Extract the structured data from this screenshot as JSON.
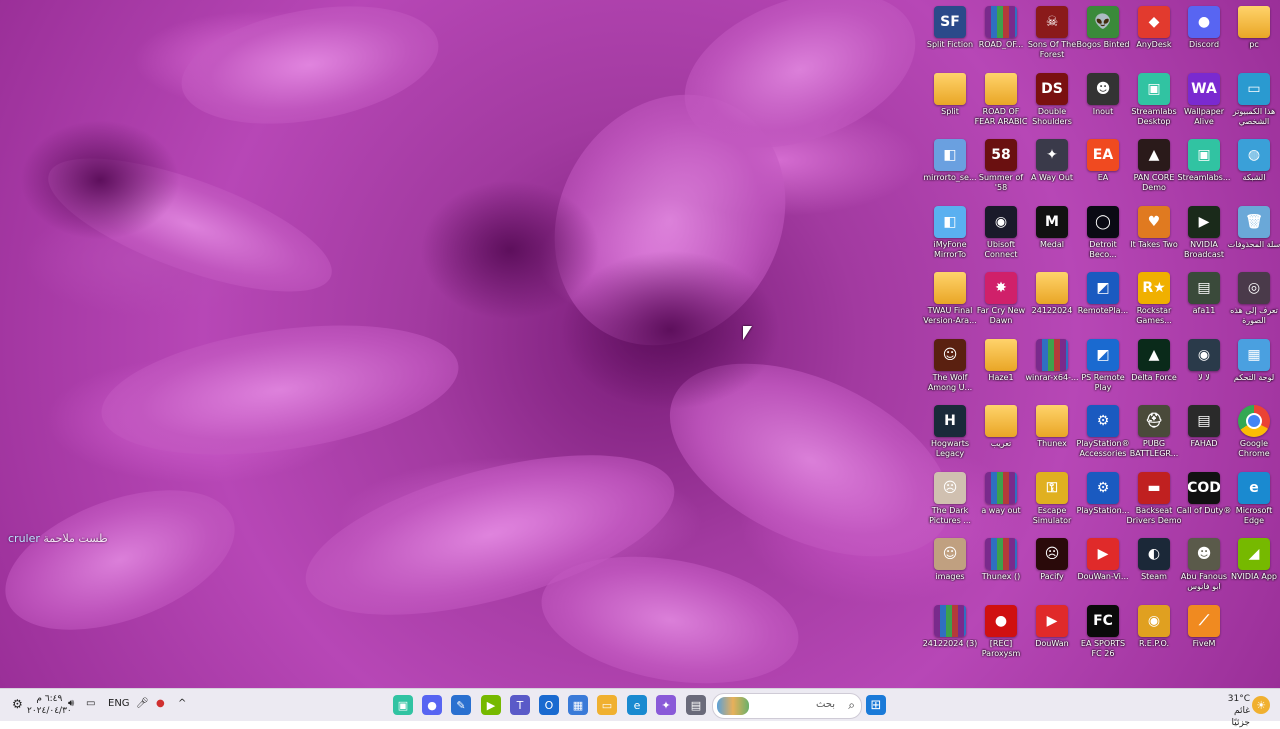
{
  "desktop": {
    "watermark": {
      "text": "طست ملاحمة",
      "brand": "cruler"
    },
    "icons": [
      {
        "label": "Split Fiction",
        "icon": "split-fiction-icon",
        "color": "#2b4a8a",
        "glyph": "SF",
        "kind": "app"
      },
      {
        "label": "ROAD_OF...",
        "icon": "winrar-archive-icon",
        "color": "#7a2a8c",
        "glyph": "",
        "kind": "rar"
      },
      {
        "label": "Sons Of The Forest",
        "icon": "sons-of-the-forest-icon",
        "color": "#8a1a1a",
        "glyph": "☠",
        "kind": "app"
      },
      {
        "label": "Bogos Binted",
        "icon": "alien-icon",
        "color": "#3a8a3a",
        "glyph": "👽",
        "kind": "app"
      },
      {
        "label": "AnyDesk",
        "icon": "anydesk-icon",
        "color": "#e23a2e",
        "glyph": "◆",
        "kind": "app"
      },
      {
        "label": "Discord",
        "icon": "discord-icon",
        "color": "#5865f2",
        "glyph": "●",
        "kind": "app"
      },
      {
        "label": "pc",
        "icon": "folder-icon",
        "color": "#f0c040",
        "glyph": "",
        "kind": "folder"
      },
      {
        "label": "Split",
        "icon": "folder-icon",
        "color": "#f0c040",
        "glyph": "",
        "kind": "folder"
      },
      {
        "label": "ROAD OF FEAR ARABIC",
        "icon": "folder-icon",
        "color": "#f0c040",
        "glyph": "",
        "kind": "folder"
      },
      {
        "label": "Double Shoulders",
        "icon": "double-shoulders-icon",
        "color": "#7a1010",
        "glyph": "DS",
        "kind": "app"
      },
      {
        "label": "Inout",
        "icon": "inout-icon",
        "color": "#333333",
        "glyph": "☻",
        "kind": "app"
      },
      {
        "label": "Streamlabs Desktop",
        "icon": "streamlabs-icon",
        "color": "#31c3a2",
        "glyph": "▣",
        "kind": "app"
      },
      {
        "label": "Wallpaper Alive",
        "icon": "wallpaper-alive-icon",
        "color": "#7a2ad0",
        "glyph": "WA",
        "kind": "app"
      },
      {
        "label": "هذا الكمبيوتر الشخصي",
        "icon": "this-pc-icon",
        "color": "#2a9ad0",
        "glyph": "▭",
        "kind": "app"
      },
      {
        "label": "mirrorto_se...",
        "icon": "mirrorto-icon",
        "color": "#6aa0e0",
        "glyph": "◧",
        "kind": "app"
      },
      {
        "label": "Summer of '58",
        "icon": "summer-of-58-icon",
        "color": "#6a1010",
        "glyph": "58",
        "kind": "app"
      },
      {
        "label": "A Way Out",
        "icon": "a-way-out-icon",
        "color": "#3a3a4a",
        "glyph": "✦",
        "kind": "app"
      },
      {
        "label": "EA",
        "icon": "ea-icon",
        "color": "#f04a20",
        "glyph": "EA",
        "kind": "app"
      },
      {
        "label": "PAN CORE Demo",
        "icon": "pan-core-icon",
        "color": "#2a1a1a",
        "glyph": "▲",
        "kind": "app"
      },
      {
        "label": "Streamlabs...",
        "icon": "streamlabs-icon",
        "color": "#31c3a2",
        "glyph": "▣",
        "kind": "app"
      },
      {
        "label": "الشبكة",
        "icon": "network-icon",
        "color": "#3aa0d8",
        "glyph": "◍",
        "kind": "app"
      },
      {
        "label": "iMyFone MirrorTo",
        "icon": "imyfone-mirrorto-icon",
        "color": "#5ab0f0",
        "glyph": "◧",
        "kind": "app"
      },
      {
        "label": "Ubisoft Connect",
        "icon": "ubisoft-icon",
        "color": "#1a1a2a",
        "glyph": "◉",
        "kind": "app"
      },
      {
        "label": "Medal",
        "icon": "medal-icon",
        "color": "#111111",
        "glyph": "M",
        "kind": "app"
      },
      {
        "label": "Detroit Beco...",
        "icon": "detroit-icon",
        "color": "#0a0a14",
        "glyph": "◯",
        "kind": "app"
      },
      {
        "label": "It Takes Two",
        "icon": "it-takes-two-icon",
        "color": "#e07a20",
        "glyph": "♥",
        "kind": "app"
      },
      {
        "label": "NVIDIA Broadcast",
        "icon": "nvidia-broadcast-icon",
        "color": "#1a2a1a",
        "glyph": "▶",
        "kind": "app"
      },
      {
        "label": "سلة المحذوفات",
        "icon": "recycle-bin-icon",
        "color": "#6aa8d8",
        "glyph": "🗑",
        "kind": "app"
      },
      {
        "label": "TWAU Final Version-Ara...",
        "icon": "folder-icon",
        "color": "#f0c040",
        "glyph": "",
        "kind": "folder"
      },
      {
        "label": "Far Cry New Dawn",
        "icon": "far-cry-icon",
        "color": "#d0206a",
        "glyph": "✸",
        "kind": "app"
      },
      {
        "label": "24122024",
        "icon": "folder-icon",
        "color": "#f0c040",
        "glyph": "",
        "kind": "folder"
      },
      {
        "label": "RemotePla...",
        "icon": "remote-play-icon",
        "color": "#1a5ac0",
        "glyph": "◩",
        "kind": "app"
      },
      {
        "label": "Rockstar Games...",
        "icon": "rockstar-icon",
        "color": "#f0b000",
        "glyph": "R★",
        "kind": "app"
      },
      {
        "label": "afa11",
        "icon": "video-file-icon",
        "color": "#3a4a3a",
        "glyph": "▤",
        "kind": "app"
      },
      {
        "label": "تعرف إلى هذه الصورة",
        "icon": "learn-about-picture-icon",
        "color": "#4a3a4a",
        "glyph": "◎",
        "kind": "app"
      },
      {
        "label": "The Wolf Among U...",
        "icon": "wolf-among-us-icon",
        "color": "#5a2010",
        "glyph": "☺",
        "kind": "app"
      },
      {
        "label": "Haze1",
        "icon": "folder-icon",
        "color": "#f0c040",
        "glyph": "",
        "kind": "folder"
      },
      {
        "label": "winrar-x64-...",
        "icon": "winrar-archive-icon",
        "color": "#7a2a8c",
        "glyph": "",
        "kind": "rar"
      },
      {
        "label": "PS Remote Play",
        "icon": "ps-remote-play-icon",
        "color": "#1a6ad0",
        "glyph": "◩",
        "kind": "app"
      },
      {
        "label": "Delta Force",
        "icon": "delta-force-icon",
        "color": "#0a2a1a",
        "glyph": "▲",
        "kind": "app"
      },
      {
        "label": "لا لا",
        "icon": "video-file-icon",
        "color": "#2a3a4a",
        "glyph": "◉",
        "kind": "app"
      },
      {
        "label": "لوحة التحكم",
        "icon": "control-panel-icon",
        "color": "#4aa0e0",
        "glyph": "▦",
        "kind": "app"
      },
      {
        "label": "Hogwarts Legacy",
        "icon": "hogwarts-legacy-icon",
        "color": "#1a2a3a",
        "glyph": "H",
        "kind": "app"
      },
      {
        "label": "تعريب",
        "icon": "folder-icon",
        "color": "#f0c040",
        "glyph": "",
        "kind": "folder"
      },
      {
        "label": "Thunex",
        "icon": "folder-icon",
        "color": "#f0c040",
        "glyph": "",
        "kind": "folder"
      },
      {
        "label": "PlayStation® Accessories",
        "icon": "playstation-icon",
        "color": "#1a5ac0",
        "glyph": "⚙",
        "kind": "app"
      },
      {
        "label": "PUBG BATTLEGR...",
        "icon": "pubg-icon",
        "color": "#4a4a3a",
        "glyph": "⛑",
        "kind": "app"
      },
      {
        "label": "FAHAD",
        "icon": "video-file-icon",
        "color": "#2a2a2a",
        "glyph": "▤",
        "kind": "app"
      },
      {
        "label": "Google Chrome",
        "icon": "chrome-icon",
        "color": "#ffffff",
        "glyph": "◕",
        "kind": "chrome"
      },
      {
        "label": "The Dark Pictures ...",
        "icon": "dark-pictures-icon",
        "color": "#d0c0b0",
        "glyph": "☹",
        "kind": "app"
      },
      {
        "label": "a way out",
        "icon": "winrar-archive-icon",
        "color": "#7a2a8c",
        "glyph": "",
        "kind": "rar"
      },
      {
        "label": "Escape Simulator",
        "icon": "escape-simulator-icon",
        "color": "#e0b020",
        "glyph": "⚿",
        "kind": "app"
      },
      {
        "label": "PlayStation...",
        "icon": "playstation-icon",
        "color": "#1a5ac0",
        "glyph": "⚙",
        "kind": "app"
      },
      {
        "label": "Backseat Drivers Demo",
        "icon": "backseat-drivers-icon",
        "color": "#c02020",
        "glyph": "▬",
        "kind": "app"
      },
      {
        "label": "Call of Duty®",
        "icon": "call-of-duty-icon",
        "color": "#111111",
        "glyph": "COD",
        "kind": "app"
      },
      {
        "label": "Microsoft Edge",
        "icon": "edge-icon",
        "color": "#1a8ad0",
        "glyph": "e",
        "kind": "app"
      },
      {
        "label": "images",
        "icon": "image-file-icon",
        "color": "#c0a080",
        "glyph": "☺",
        "kind": "app"
      },
      {
        "label": "Thunex ()",
        "icon": "winrar-archive-icon",
        "color": "#7a2a8c",
        "glyph": "",
        "kind": "rar"
      },
      {
        "label": "Pacify",
        "icon": "pacify-icon",
        "color": "#2a0a0a",
        "glyph": "☹",
        "kind": "app"
      },
      {
        "label": "DouWan-Vi...",
        "icon": "douwan-icon",
        "color": "#e02a2a",
        "glyph": "▶",
        "kind": "app"
      },
      {
        "label": "Steam",
        "icon": "steam-icon",
        "color": "#1b2838",
        "glyph": "◐",
        "kind": "app"
      },
      {
        "label": "Abu Fanous ابو فانوس",
        "icon": "abu-fanous-icon",
        "color": "#5a5a4a",
        "glyph": "☻",
        "kind": "app"
      },
      {
        "label": "NVIDIA App",
        "icon": "nvidia-app-icon",
        "color": "#76b900",
        "glyph": "◢",
        "kind": "app"
      },
      {
        "label": "24122024 (3)",
        "icon": "winrar-archive-icon",
        "color": "#7a2a8c",
        "glyph": "",
        "kind": "rar"
      },
      {
        "label": "[REC] Paroxysm",
        "icon": "rec-paroxysm-icon",
        "color": "#d01010",
        "glyph": "●",
        "kind": "app"
      },
      {
        "label": "DouWan",
        "icon": "douwan-icon",
        "color": "#e02a2a",
        "glyph": "▶",
        "kind": "app"
      },
      {
        "label": "EA SPORTS FC 26",
        "icon": "ea-sports-fc-icon",
        "color": "#0a0a0a",
        "glyph": "FC",
        "kind": "app"
      },
      {
        "label": "R.E.P.O.",
        "icon": "repo-icon",
        "color": "#e0a020",
        "glyph": "◉",
        "kind": "app"
      },
      {
        "label": "FiveM",
        "icon": "fivem-icon",
        "color": "#f08a20",
        "glyph": "⟋",
        "kind": "app"
      }
    ]
  },
  "taskbar": {
    "clock": {
      "time": "٦:٤٩ م",
      "date": "٢٠٢٤/٠٤/٣٠"
    },
    "language": "ENG",
    "search_placeholder": "بحث",
    "weather": {
      "temp": "31°C",
      "desc": "غائم جزئيًا"
    },
    "pinned": [
      {
        "name": "streamlabs-taskbar-icon",
        "color": "#31c3a2",
        "glyph": "▣"
      },
      {
        "name": "discord-taskbar-icon",
        "color": "#5865f2",
        "glyph": "●"
      },
      {
        "name": "pen-app-taskbar-icon",
        "color": "#2a70d0",
        "glyph": "✎"
      },
      {
        "name": "nvidia-taskbar-icon",
        "color": "#76b900",
        "glyph": "▶"
      },
      {
        "name": "teams-taskbar-icon",
        "color": "#5a5ac8",
        "glyph": "T"
      },
      {
        "name": "outlook-taskbar-icon",
        "color": "#1a6ad0",
        "glyph": "O"
      },
      {
        "name": "store-taskbar-icon",
        "color": "#3a7ad8",
        "glyph": "▦"
      },
      {
        "name": "file-explorer-taskbar-icon",
        "color": "#f0b030",
        "glyph": "▭"
      },
      {
        "name": "edge-taskbar-icon",
        "color": "#1a8ad0",
        "glyph": "e"
      },
      {
        "name": "copilot-taskbar-icon",
        "color": "#8a5ad8",
        "glyph": "✦"
      },
      {
        "name": "app-taskbar-icon",
        "color": "#6a6a7a",
        "glyph": "▤"
      }
    ]
  }
}
